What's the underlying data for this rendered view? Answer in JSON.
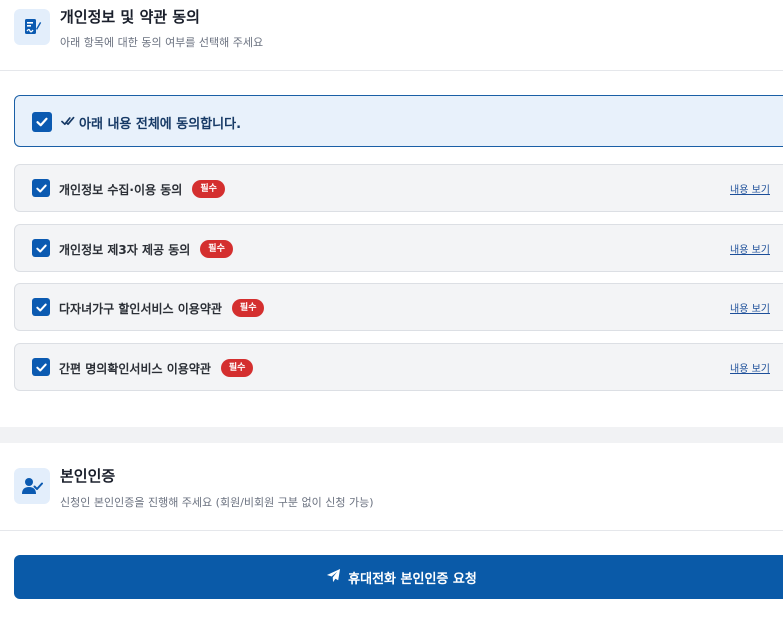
{
  "terms_section": {
    "title": "개인정보 및 약관 동의",
    "subtitle": "아래 항목에 대한 동의 여부를 선택해 주세요",
    "icon": "signature-doc-icon"
  },
  "agree_all": {
    "label": "아래 내용 전체에 동의합니다.",
    "checked": true
  },
  "terms": [
    {
      "label": "개인정보 수집·이용 동의",
      "badge": "필수",
      "link": "내용 보기",
      "checked": true
    },
    {
      "label": "개인정보 제3자 제공 동의",
      "badge": "필수",
      "link": "내용 보기",
      "checked": true
    },
    {
      "label": "다자녀가구 할인서비스 이용약관",
      "badge": "필수",
      "link": "내용 보기",
      "checked": true
    },
    {
      "label": "간편 명의확인서비스 이용약관",
      "badge": "필수",
      "link": "내용 보기",
      "checked": true
    }
  ],
  "auth_section": {
    "title": "본인인증",
    "subtitle": "신청인 본인인증을 진행해 주세요 (회원/비회원 구분 없이 신청 가능)",
    "icon": "user-check-icon"
  },
  "request_button": {
    "label": "휴대전화 본인인증 요청",
    "icon": "paper-plane-icon"
  },
  "colors": {
    "primary": "#0a5aa8",
    "badge_red": "#d42f2f",
    "icon_bg": "#e3eefb"
  }
}
